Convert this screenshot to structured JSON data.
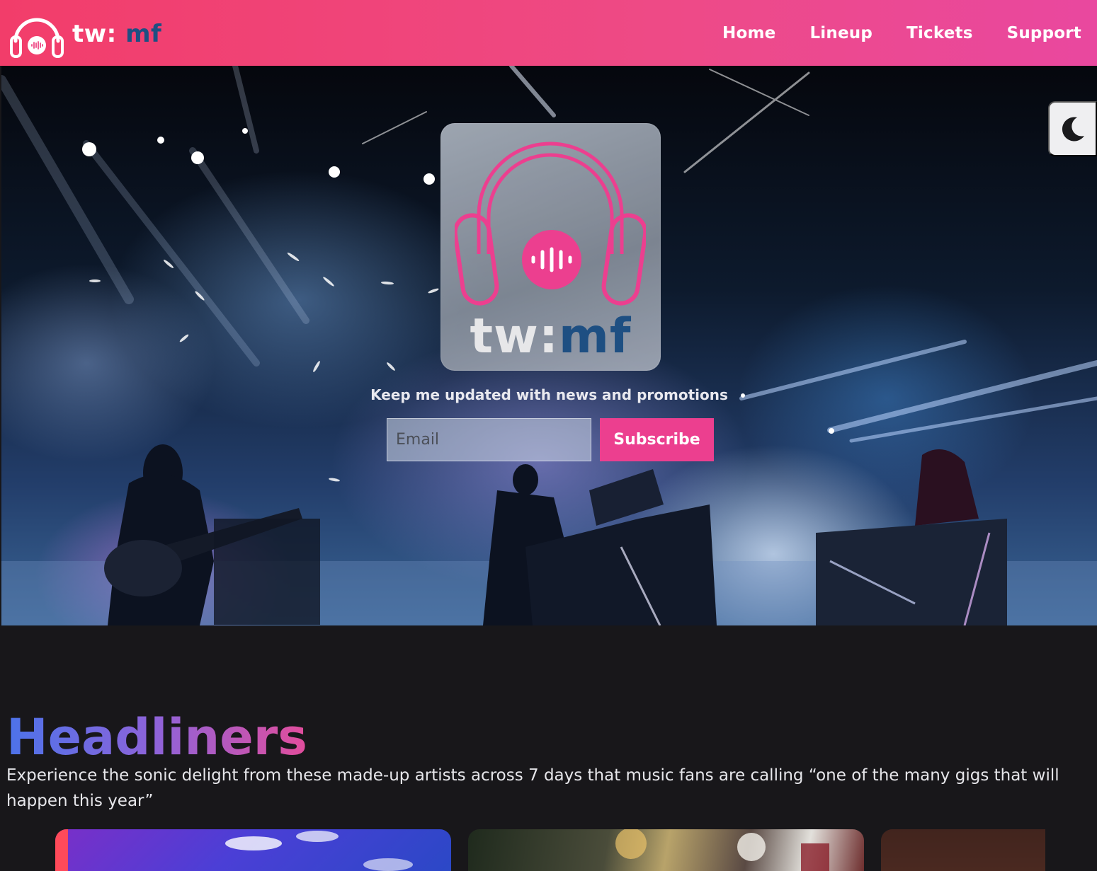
{
  "header": {
    "brand_tw": "tw:",
    "brand_mf": "mf",
    "nav": [
      {
        "label": "Home"
      },
      {
        "label": "Lineup"
      },
      {
        "label": "Tickets"
      },
      {
        "label": "Support"
      }
    ]
  },
  "hero": {
    "logo_tw": "tw:",
    "logo_mf": "mf",
    "tagline": "Keep me updated with news and promotions",
    "email_placeholder": "Email",
    "subscribe_label": "Subscribe",
    "theme_toggle_icon": "moon-icon"
  },
  "headliners": {
    "title": "Headliners",
    "description": "Experience the sonic delight from these made-up artists across 7 days that music fans are calling “one of the many gigs that will happen this year”",
    "cards": [
      {
        "image": "concert-stage-image"
      },
      {
        "image": "festival-crowd-image"
      },
      {
        "image": "artist-image"
      }
    ]
  },
  "colors": {
    "header_gradient_start": "#f23d6a",
    "header_gradient_end": "#e9489f",
    "accent_pink": "#ec3f8f",
    "brand_blue": "#1e4f82",
    "page_background": "#18171a"
  }
}
